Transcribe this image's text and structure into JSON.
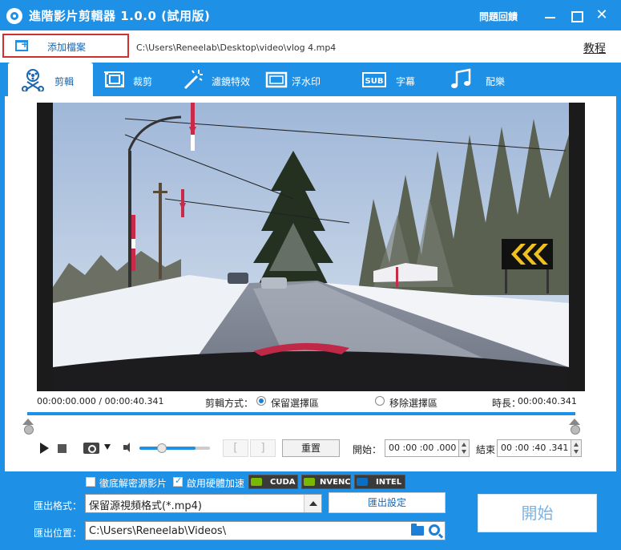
{
  "window": {
    "title": "進階影片剪輯器 1.0.0 (試用版)",
    "feedback": "問題回饋",
    "close_glyph": "✕"
  },
  "filebar": {
    "add_file_label": "添加檔案",
    "file_path": "C:\\Users\\Reneelab\\Desktop\\video\\vlog 4.mp4",
    "tutorial": "教程"
  },
  "tabs": [
    {
      "label": "剪輯",
      "icon": "scissors-reel-icon",
      "active": true
    },
    {
      "label": "裁剪",
      "icon": "crop-filmstrip-icon"
    },
    {
      "label": "濾鏡特效",
      "icon": "magic-wand-icon"
    },
    {
      "label": "浮水印",
      "icon": "watermark-frame-icon"
    },
    {
      "label": "字幕",
      "icon": "subtitle-icon",
      "icon_text": "SUB"
    },
    {
      "label": "配樂",
      "icon": "music-note-icon"
    }
  ],
  "player": {
    "current_time": "00:00:00.000",
    "total_time": "00:00:40.341",
    "edit_mode_label": "剪輯方式：",
    "keep_label": "保留選擇區",
    "remove_label": "移除選擇區",
    "selected_mode": "keep",
    "duration_label": "時長：",
    "duration_value": "00:00:40.341",
    "volume_level": 0.8,
    "mark_in": "[",
    "mark_out": "]",
    "reset_label": "重置",
    "start_label": "開始：",
    "start_time": "00 :00 :00 .000",
    "end_label": "結束：",
    "end_time": "00 :00 :40 .341"
  },
  "options": {
    "decode_label": "徹底解密源影片",
    "decode_checked": false,
    "hw_label": "啟用硬體加速",
    "hw_checked": true,
    "badges": [
      "CUDA",
      "NVENC",
      "INTEL"
    ]
  },
  "export": {
    "format_label": "匯出格式：",
    "format_value": "保留源視頻格式(*.mp4)",
    "settings_label": "匯出設定",
    "output_label": "匯出位置：",
    "output_value": "C:\\Users\\Reneelab\\Videos\\",
    "start_button": "開始"
  },
  "colors": {
    "accent": "#1e90e6",
    "highlight_border": "#d03030"
  }
}
